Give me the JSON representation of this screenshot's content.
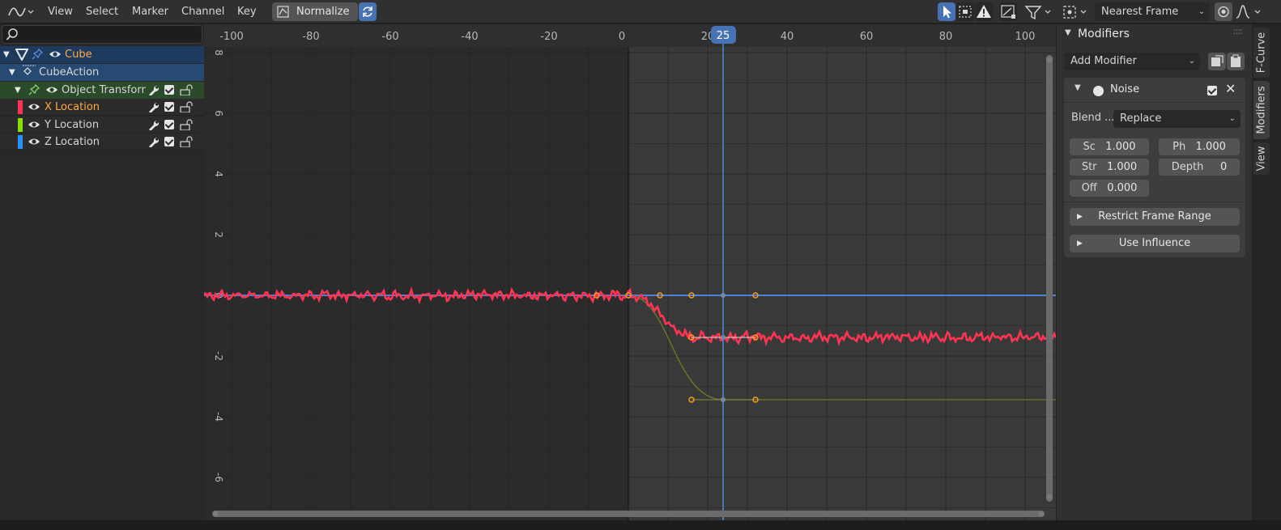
{
  "header": {
    "editor_type_icon": "graph-editor-icon",
    "menus": [
      "View",
      "Select",
      "Marker",
      "Channel",
      "Key"
    ],
    "normalize_label": "Normalize",
    "auto_snapping": "Nearest Frame"
  },
  "channels": {
    "search_placeholder": "",
    "rows": [
      {
        "label": "Cube",
        "color": "#ffaa40"
      },
      {
        "label": "CubeAction",
        "color": "#d6d6d6"
      },
      {
        "label": "Object Transform",
        "color": "#d6d6d6"
      },
      {
        "label": "X Location",
        "color": "#ffaa40",
        "channel_color": "#ff3352"
      },
      {
        "label": "Y Location",
        "color": "#d6d6d6",
        "channel_color": "#8bdc00"
      },
      {
        "label": "Z Location",
        "color": "#d6d6d6",
        "channel_color": "#2890ff"
      }
    ]
  },
  "graph": {
    "current_frame": "25",
    "frame_ticks": [
      "-100",
      "-80",
      "-60",
      "-40",
      "-20",
      "0",
      "20",
      "40",
      "60",
      "80",
      "100"
    ],
    "value_ticks": [
      "8",
      "6",
      "4",
      "2",
      "0",
      "-2",
      "-4",
      "-6"
    ]
  },
  "sidebar": {
    "panel_title": "Modifiers",
    "add_modifier": "Add Modifier",
    "modifier": {
      "name": "Noise",
      "blend_label": "Blend ...",
      "blend_value": "Replace",
      "fields": {
        "scale_label": "Sc",
        "scale_value": "1.000",
        "phase_label": "Ph",
        "phase_value": "1.000",
        "strength_label": "Str",
        "strength_value": "1.000",
        "depth_label": "Depth",
        "depth_value": "0",
        "offset_label": "Off",
        "offset_value": "0.000"
      },
      "restrict_frame_range": "Restrict Frame Range",
      "use_influence": "Use Influence"
    }
  },
  "tabs": [
    "F-Curve",
    "Modifiers",
    "View"
  ]
}
